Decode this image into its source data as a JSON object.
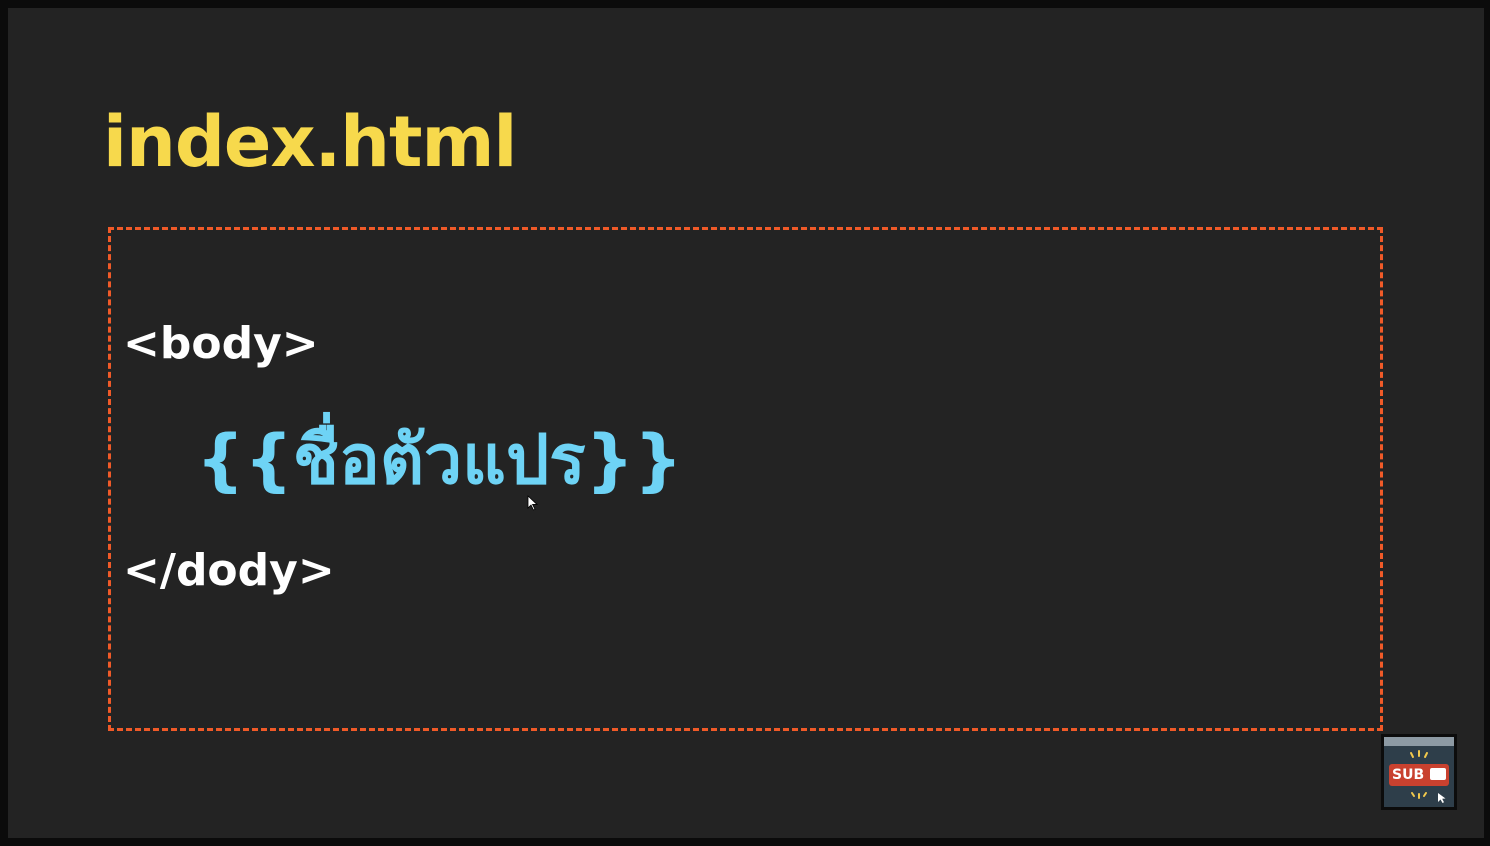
{
  "slide": {
    "file_title": "index.html",
    "code": {
      "open_tag": "<body>",
      "template_variable": "{{ชื่อตัวแปร}}",
      "close_tag": "</dody>"
    }
  },
  "badge": {
    "label": "SUB",
    "icon": "subscribe-icon"
  },
  "colors": {
    "background": "#232323",
    "title": "#f7d94c",
    "dashed_frame": "#f05a28",
    "tag_text": "#ffffff",
    "variable_text": "#6ed3f5",
    "badge_red": "#c9412f"
  }
}
